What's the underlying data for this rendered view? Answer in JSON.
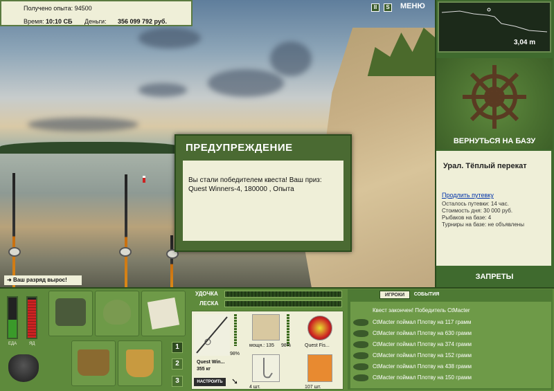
{
  "top_info": {
    "exp_label": "Получено опыта: 94500",
    "time_label": "Время:",
    "time_value": "10:10 СБ",
    "money_label": "Деньги:",
    "money_value": "356 099 792 руб."
  },
  "top_buttons": {
    "pause": "II",
    "sound": "S",
    "menu": "МЕНЮ"
  },
  "depth": {
    "value": "3,04 m"
  },
  "right": {
    "return_label": "ВЕРНУТЬСЯ НА БАЗУ",
    "base_title": "Урал. Тёплый перекат",
    "extend_link": "Продлить путевку",
    "lines": [
      "Осталось путевки: 14 час.",
      "Стоимость дня: 30 000 руб.",
      "Рыбаков на базе: 4",
      "Турниры на базе: не объявлены"
    ],
    "bans_label": "ЗАПРЕТЫ"
  },
  "dialog": {
    "title": "ПРЕДУПРЕЖДЕНИЕ",
    "body": "Вы стали победителем квеста! Ваш приз: Quest Winners-4, 180000 , Опыта"
  },
  "rank_toast": "Ваш разряд вырос!",
  "meters": {
    "food_label": "ЕДА",
    "poison_label": "ЯД",
    "food_level": 0.45,
    "poison_level": 0.95
  },
  "pages": [
    "1",
    "2",
    "3"
  ],
  "tackle": {
    "rod_label": "УДОЧКА",
    "line_label": "ЛЕСКА",
    "rod_name": "Quest Win...",
    "rod_weight": "355 кг",
    "rod_percent": "98%",
    "reel_power": "мощн.: 135",
    "reel_percent": "98%",
    "line_name": "Quest Fis...",
    "hooks_count": "4 шт.",
    "bait_count": "107 шт.",
    "configure": "НАСТРОИТЬ"
  },
  "events": {
    "tab_players": "ИГРОКИ",
    "tab_events": "СОБЫТИЯ",
    "header": "Квест закончен! Победитель CtMacter",
    "rows": [
      "CtMacter поймал Плотву на 117 грамм",
      "CtMacter поймал Плотву на 630 грамм",
      "CtMacter поймал Плотву на 374 грамм",
      "CtMacter поймал Плотву на 152 грамм",
      "CtMacter поймал Плотву на 438 грамм",
      "CtMacter поймал Плотву на 150 грамм"
    ]
  },
  "colors": {
    "panel_green": "#3f6a2e",
    "panel_light": "#efefd8",
    "link": "#0033aa"
  }
}
